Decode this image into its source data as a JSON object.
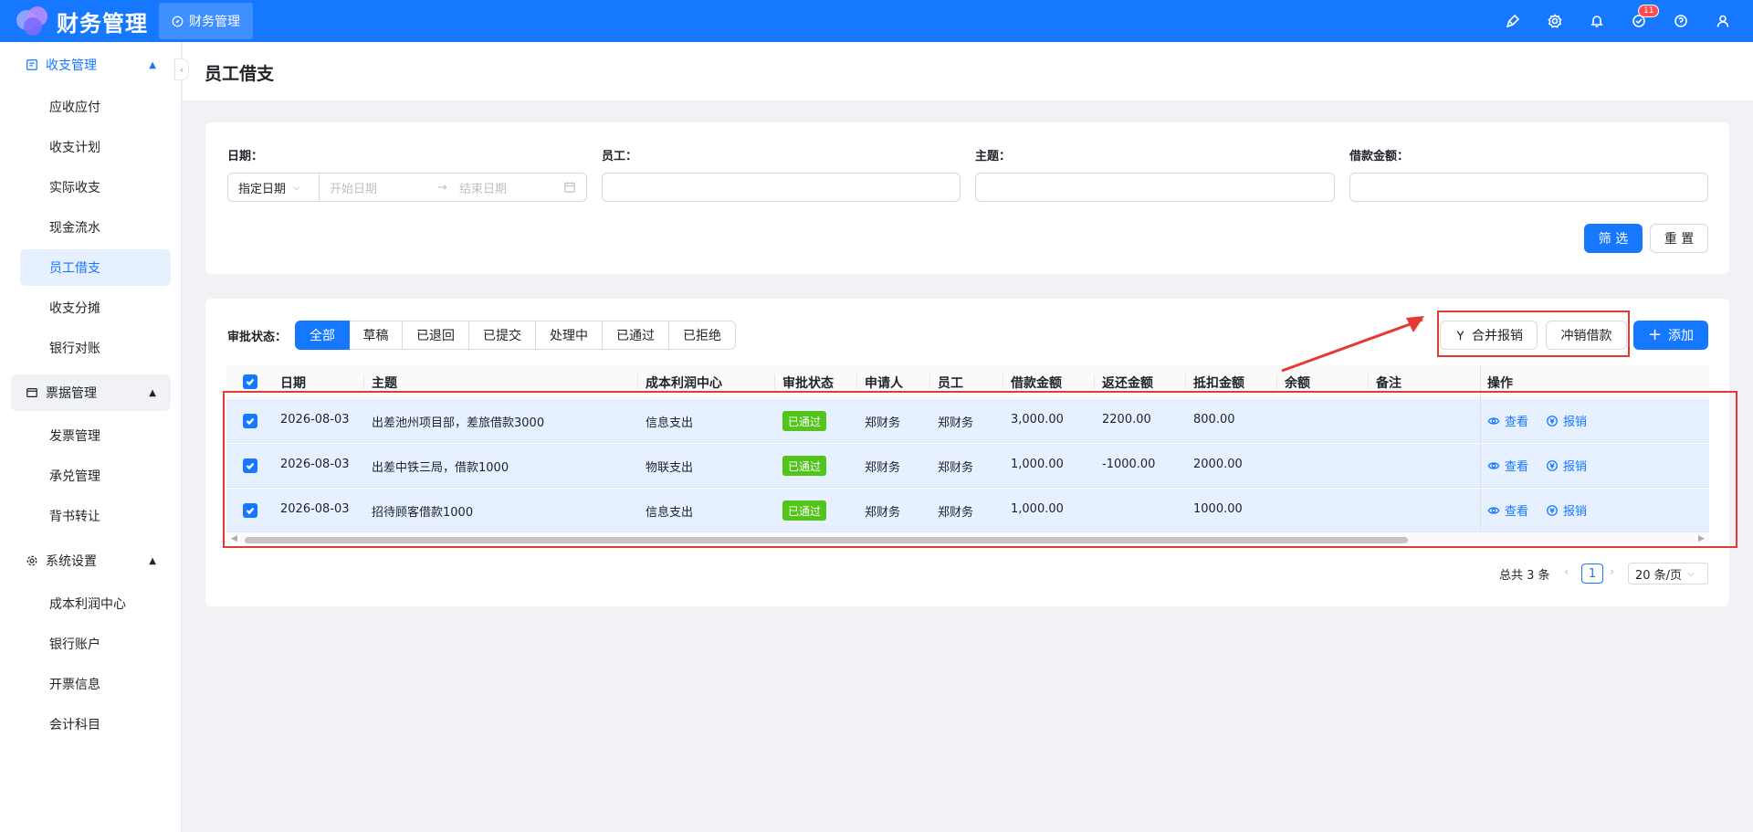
{
  "app": {
    "brand": "财务管理",
    "top_tab": "财务管理",
    "notification_count": "11"
  },
  "sidebar": {
    "groups": [
      {
        "label": "收支管理",
        "items": [
          "应收应付",
          "收支计划",
          "实际收支",
          "现金流水",
          "员工借支",
          "收支分摊",
          "银行对账"
        ]
      },
      {
        "label": "票据管理",
        "items": [
          "发票管理",
          "承兑管理",
          "背书转让"
        ]
      },
      {
        "label": "系统设置",
        "items": [
          "成本利润中心",
          "银行账户",
          "开票信息",
          "会计科目"
        ]
      }
    ],
    "selected": "员工借支"
  },
  "page": {
    "title": "员工借支"
  },
  "filters": {
    "date_label": "日期：",
    "date_mode": "指定日期",
    "start_placeholder": "开始日期",
    "end_placeholder": "结束日期",
    "employee_label": "员工：",
    "subject_label": "主题：",
    "amount_label": "借款金额：",
    "filter_button": "筛 选",
    "reset_button": "重 置"
  },
  "status": {
    "label": "审批状态：",
    "options": [
      "全部",
      "草稿",
      "已退回",
      "已提交",
      "处理中",
      "已通过",
      "已拒绝"
    ],
    "selected": "全部"
  },
  "actions": {
    "merge": "合并报销",
    "offset": "冲销借款",
    "add": "添加"
  },
  "table": {
    "columns": [
      "日期",
      "主题",
      "成本利润中心",
      "审批状态",
      "申请人",
      "员工",
      "借款金额",
      "返还金额",
      "抵扣金额",
      "余额",
      "备注",
      "操作"
    ],
    "rows": [
      {
        "date": "2026-08-03",
        "subject": "出差池州项目部，差旅借款3000",
        "center": "信息支出",
        "status": "已通过",
        "applicant": "郑财务",
        "employee": "郑财务",
        "loan": "3,000.00",
        "returned": "2200.00",
        "deducted": "800.00",
        "balance": "",
        "remark": "",
        "view": "查看",
        "reimburse": "报销"
      },
      {
        "date": "2026-08-03",
        "subject": "出差中铁三局，借款1000",
        "center": "物联支出",
        "status": "已通过",
        "applicant": "郑财务",
        "employee": "郑财务",
        "loan": "1,000.00",
        "returned": "-1000.00",
        "deducted": "2000.00",
        "balance": "",
        "remark": "",
        "view": "查看",
        "reimburse": "报销"
      },
      {
        "date": "2026-08-03",
        "subject": "招待顾客借款1000",
        "center": "信息支出",
        "status": "已通过",
        "applicant": "郑财务",
        "employee": "郑财务",
        "loan": "1,000.00",
        "returned": "",
        "deducted": "1000.00",
        "balance": "",
        "remark": "",
        "view": "查看",
        "reimburse": "报销"
      }
    ]
  },
  "pagination": {
    "total": "总共 3 条",
    "current": "1",
    "page_size": "20 条/页"
  },
  "colors": {
    "primary": "#1677ff",
    "success": "#52c41a",
    "annotation": "#e53935"
  }
}
